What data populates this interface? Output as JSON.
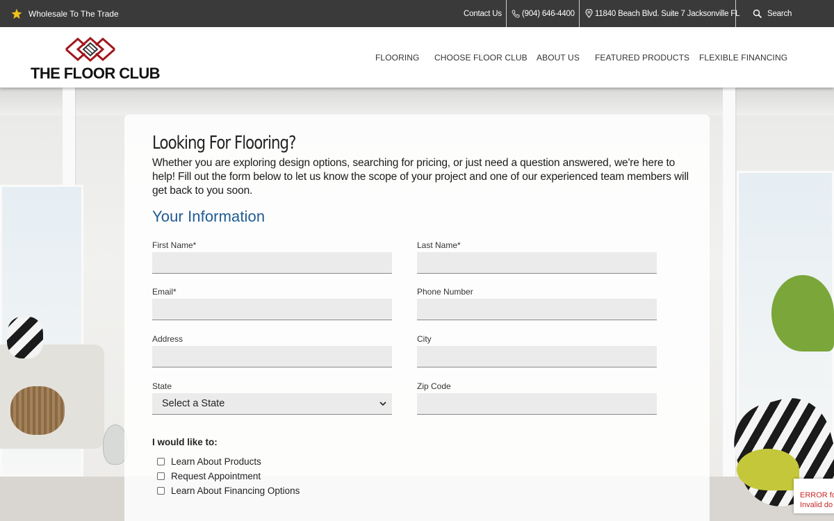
{
  "topbar": {
    "trade_label": "Wholesale To The Trade",
    "contact_label": "Contact Us",
    "phone_label": "(904) 646-4400",
    "address_label": "11840 Beach Blvd. Suite 7 Jacksonville FL",
    "search_label": "Search"
  },
  "logo": {
    "text": "THE FLOOR CLUB",
    "accent_color": "#a0171c"
  },
  "nav": {
    "items": [
      "FLOORING",
      "CHOOSE FLOOR CLUB",
      "ABOUT US",
      "FEATURED PRODUCTS",
      "FLEXIBLE FINANCING"
    ]
  },
  "form": {
    "title": "Looking For Flooring?",
    "intro": "Whether you are exploring design options, searching for pricing, or just need a question answered, we're here to help! Fill out the form below to let us know the scope of your project and one of our experienced team members will get back to you soon.",
    "section_title": "Your Information",
    "section_color": "#1f5b93",
    "fields": {
      "first_name": "First Name*",
      "last_name": "Last Name*",
      "email": "Email*",
      "phone": "Phone Number",
      "address": "Address",
      "city": "City",
      "state": "State",
      "zip": "Zip Code"
    },
    "state_value": "Select a State",
    "would_like_label": "I would like to:",
    "options": [
      "Learn About Products",
      "Request Appointment",
      "Learn About Financing Options"
    ]
  },
  "error_badge": {
    "line1": "ERROR fo",
    "line2": "Invalid do"
  }
}
